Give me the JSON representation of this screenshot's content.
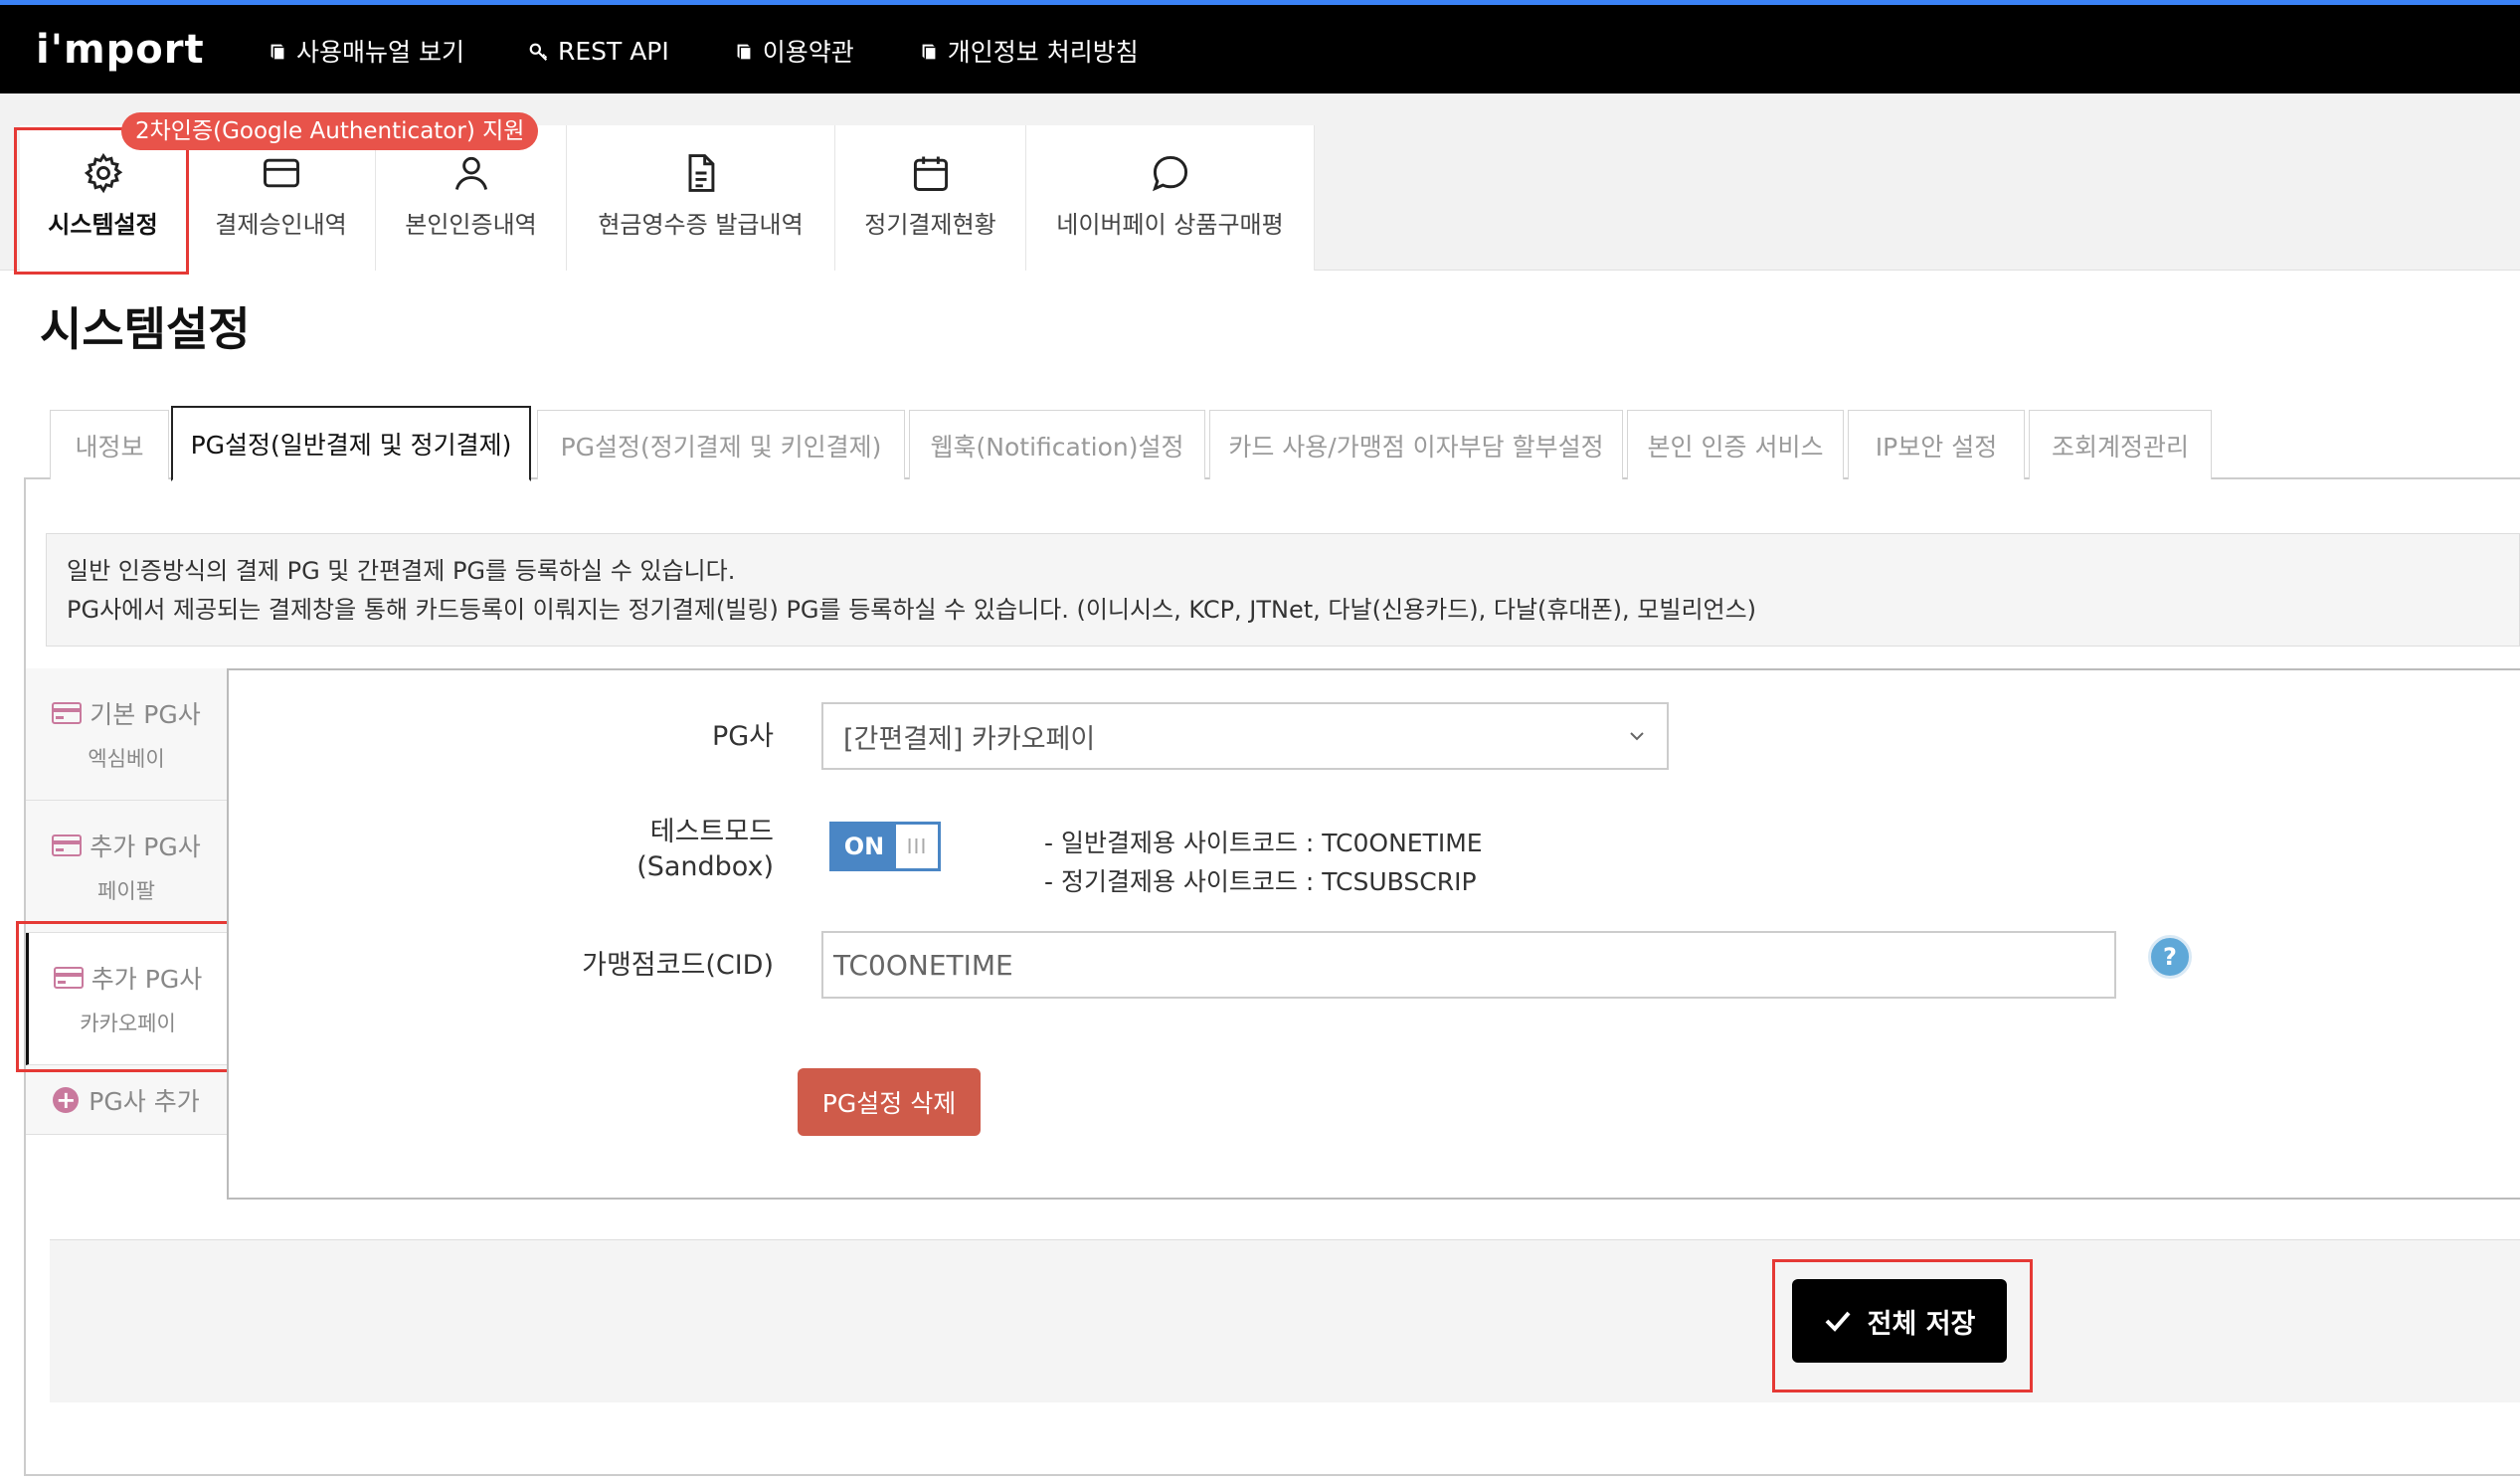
{
  "brand": {
    "logo_text": "i'mport"
  },
  "top_nav": [
    {
      "label": "사용매뉴얼 보기",
      "icon": "book-icon"
    },
    {
      "label": "REST API",
      "icon": "key-icon"
    },
    {
      "label": "이용약관",
      "icon": "book-icon"
    },
    {
      "label": "개인정보 처리방침",
      "icon": "book-icon"
    }
  ],
  "icon_tabs": [
    {
      "label": "시스템설정",
      "icon": "gear-icon",
      "active": true
    },
    {
      "label": "결제승인내역",
      "icon": "credit-card-icon"
    },
    {
      "label": "본인인증내역",
      "icon": "user-icon"
    },
    {
      "label": "현금영수증 발급내역",
      "icon": "document-icon"
    },
    {
      "label": "정기결제현황",
      "icon": "calendar-icon"
    },
    {
      "label": "네이버페이 상품구매평",
      "icon": "chat-bubble-icon"
    }
  ],
  "badge_2fa": "2차인증(Google Authenticator) 지원",
  "page_title": "시스템설정",
  "tabs": [
    {
      "label": "내정보"
    },
    {
      "label": "PG설정(일반결제 및 정기결제)",
      "active": true
    },
    {
      "label": "PG설정(정기결제 및 키인결제)"
    },
    {
      "label": "웹훅(Notification)설정"
    },
    {
      "label": "카드 사용/가맹점 이자부담 할부설정"
    },
    {
      "label": "본인 인증 서비스"
    },
    {
      "label": "IP보안 설정"
    },
    {
      "label": "조회계정관리"
    }
  ],
  "notice": {
    "line1": "일반 인증방식의 결제 PG 및 간편결제 PG를 등록하실 수 있습니다.",
    "line2": "PG사에서 제공되는 결제창을 통해 카드등록이 이뤄지는 정기결제(빌링) PG를 등록하실 수 있습니다. (이니시스, KCP, JTNet, 다날(신용카드), 다날(휴대폰), 모빌리언스)"
  },
  "pg_sidebar": [
    {
      "title": "기본 PG사",
      "sub": "엑심베이"
    },
    {
      "title": "추가 PG사",
      "sub": "페이팔"
    },
    {
      "title": "추가 PG사",
      "sub": "카카오페이",
      "active": true
    }
  ],
  "add_pg_label": "PG사 추가",
  "form": {
    "pg_label": "PG사",
    "pg_selected": "[간편결제] 카카오페이",
    "testmode_label_1": "테스트모드",
    "testmode_label_2": "(Sandbox)",
    "toggle_on": "ON",
    "toggle_knob": "III",
    "sitecode_1": "- 일반결제용 사이트코드 : TC0ONETIME",
    "sitecode_2": "- 정기결제용 사이트코드 : TCSUBSCRIP",
    "cid_label": "가맹점코드(CID)",
    "cid_value": "TC0ONETIME",
    "help": "?",
    "delete_button": "PG설정 삭제"
  },
  "save_button": "전체 저장",
  "colors": {
    "accent_red": "#e53935",
    "toggle_blue": "#4a86c5",
    "delete_red": "#cf5b4a",
    "badge_red": "#e8534a"
  }
}
